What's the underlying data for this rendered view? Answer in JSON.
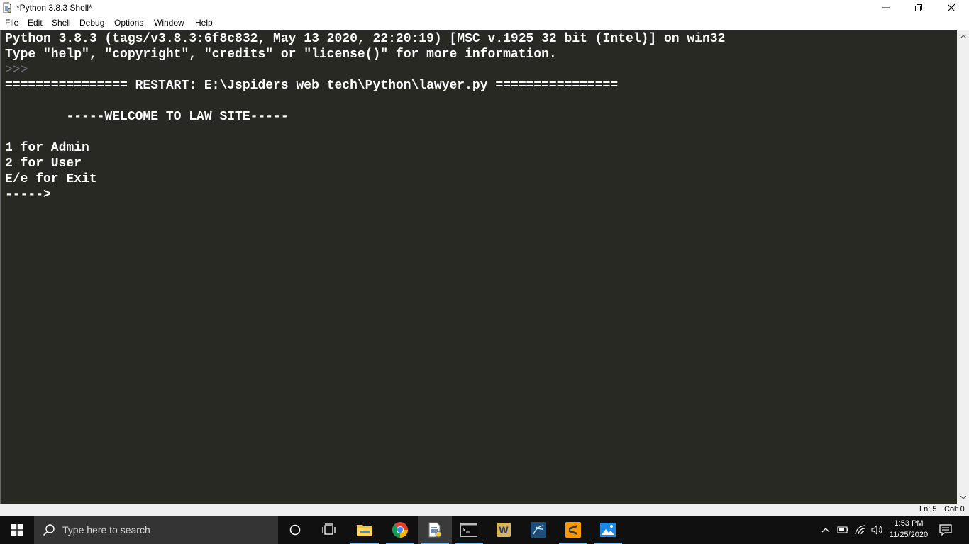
{
  "window": {
    "title": "*Python 3.8.3 Shell*"
  },
  "menu": [
    "File",
    "Edit",
    "Shell",
    "Debug",
    "Options",
    "Window",
    "Help"
  ],
  "shell": {
    "lines": [
      {
        "text": "Python 3.8.3 (tags/v3.8.3:6f8c832, May 13 2020, 22:20:19) [MSC v.1925 32 bit (Intel)] on win32",
        "kind": "output"
      },
      {
        "text": "Type \"help\", \"copyright\", \"credits\" or \"license()\" for more information.",
        "kind": "output"
      },
      {
        "text": ">>> ",
        "kind": "prompt"
      },
      {
        "text": "================ RESTART: E:\\Jspiders web tech\\Python\\lawyer.py ================",
        "kind": "output"
      },
      {
        "text": "",
        "kind": "output"
      },
      {
        "text": "        -----WELCOME TO LAW SITE-----",
        "kind": "output"
      },
      {
        "text": "",
        "kind": "output"
      },
      {
        "text": "1 for Admin",
        "kind": "output"
      },
      {
        "text": "2 for User",
        "kind": "output"
      },
      {
        "text": "E/e for Exit",
        "kind": "output"
      },
      {
        "text": "----->",
        "kind": "output"
      }
    ],
    "background": "#282923",
    "foreground": "#ffffff",
    "prompt_color": "#6b6e7a"
  },
  "status": {
    "ln": "Ln: 5",
    "col": "Col: 0"
  },
  "taskbar": {
    "search_placeholder": "Type here to search",
    "apps": [
      "cortana-icon",
      "task-view-icon",
      "file-explorer-icon",
      "chrome-icon",
      "python-idle-icon",
      "terminal-icon",
      "word-icon",
      "mysql-workbench-icon",
      "sublime-text-icon",
      "photos-icon"
    ],
    "active_app": "python-idle-icon",
    "clock": {
      "time": "1:53 PM",
      "date": "11/25/2020"
    },
    "accent": "#76b9ed"
  }
}
